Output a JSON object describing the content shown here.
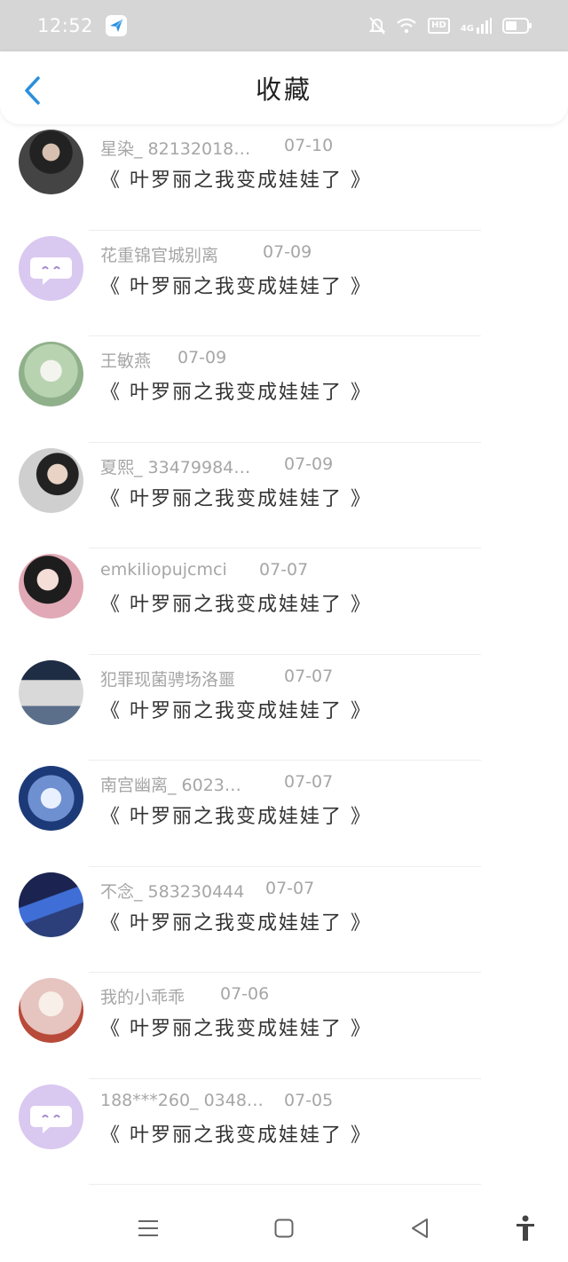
{
  "status_bar": {
    "time": "12:52",
    "hd_label": "HD",
    "network_label": "4G",
    "icons": [
      "app-badge-icon",
      "mute-bell-icon",
      "wifi-icon",
      "signal-icon",
      "battery-icon"
    ]
  },
  "header": {
    "title": "收藏",
    "back_icon": "chevron-left-icon",
    "accent_color": "#2a8fdc"
  },
  "items": [
    {
      "user": "星染_ 82132018…",
      "date": "07-10",
      "title": "《 叶罗丽之我变成娃娃了 》",
      "avatar_icon": "photo-avatar",
      "avatar_color": "#3a3a3a"
    },
    {
      "user": "花重锦官城别离",
      "date": "07-09",
      "title": "《 叶罗丽之我变成娃娃了 》",
      "avatar_icon": "default-chat-avatar",
      "avatar_color": "#d9c8f0"
    },
    {
      "user": "王敏燕",
      "date": "07-09",
      "title": "《 叶罗丽之我变成娃娃了 》",
      "avatar_icon": "photo-avatar",
      "avatar_color": "#b8d3b0"
    },
    {
      "user": "夏熙_ 33479984…",
      "date": "07-09",
      "title": "《 叶罗丽之我变成娃娃了 》",
      "avatar_icon": "photo-avatar",
      "avatar_color": "#cfcfcf"
    },
    {
      "user": "emkiliopujcmci",
      "date": "07-07",
      "title": "《 叶罗丽之我变成娃娃了 》",
      "avatar_icon": "photo-avatar",
      "avatar_color": "#e0a9b5"
    },
    {
      "user": "犯罪现菌骋场洛噩",
      "date": "07-07",
      "title": "《 叶罗丽之我变成娃娃了 》",
      "avatar_icon": "photo-avatar",
      "avatar_color": "#5b6e8a"
    },
    {
      "user": "南宫幽离_ 6023…",
      "date": "07-07",
      "title": "《 叶罗丽之我变成娃娃了 》",
      "avatar_icon": "photo-avatar",
      "avatar_color": "#2d4f8c"
    },
    {
      "user": "不念_ 583230444",
      "date": "07-07",
      "title": "《 叶罗丽之我变成娃娃了 》",
      "avatar_icon": "photo-avatar",
      "avatar_color": "#2c3f7a"
    },
    {
      "user": "我的小乖乖",
      "date": "07-06",
      "title": "《 叶罗丽之我变成娃娃了 》",
      "avatar_icon": "photo-avatar",
      "avatar_color": "#e6c4c0"
    },
    {
      "user": "188***260_ 0348…",
      "date": "07-05",
      "title": "《 叶罗丽之我变成娃娃了 》",
      "avatar_icon": "default-chat-avatar",
      "avatar_color": "#d9c8f0"
    }
  ],
  "nav_bar": {
    "icons": [
      "menu-icon",
      "home-square-icon",
      "back-triangle-icon",
      "accessibility-icon"
    ]
  }
}
